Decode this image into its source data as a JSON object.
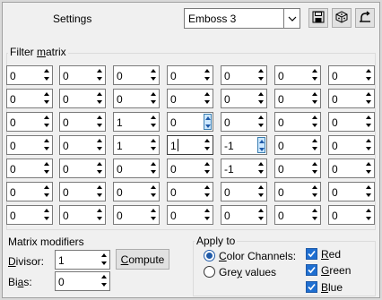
{
  "settings": {
    "label": "Settings",
    "preset_value": "Emboss 3"
  },
  "icons": {
    "save": "save-icon",
    "load": "dice-icon",
    "reset": "reset-icon",
    "dropdown": "chevron-down-icon"
  },
  "matrix": {
    "title_pre": "Filter ",
    "title_u": "m",
    "title_post": "atrix",
    "rows": [
      [
        "0",
        "0",
        "0",
        "0",
        "0",
        "0",
        "0"
      ],
      [
        "0",
        "0",
        "0",
        "0",
        "0",
        "0",
        "0"
      ],
      [
        "0",
        "0",
        "1",
        "0",
        "0",
        "0",
        "0"
      ],
      [
        "0",
        "0",
        "1",
        "1",
        "-1",
        "0",
        "0"
      ],
      [
        "0",
        "0",
        "0",
        "0",
        "-1",
        "0",
        "0"
      ],
      [
        "0",
        "0",
        "0",
        "0",
        "0",
        "0",
        "0"
      ],
      [
        "0",
        "0",
        "0",
        "0",
        "0",
        "0",
        "0"
      ]
    ]
  },
  "modifiers": {
    "title": "Matrix modifiers",
    "divisor_label_u": "D",
    "divisor_label_rest": "ivisor:",
    "divisor_value": "1",
    "compute_u": "C",
    "compute_rest": "ompute",
    "bias_label_pre": "Bi",
    "bias_label_u": "a",
    "bias_label_post": "s:",
    "bias_value": "0"
  },
  "apply": {
    "title": "Apply to",
    "color_u": "C",
    "color_rest": "olor Channels:",
    "grey_pre": "Gre",
    "grey_u": "y",
    "grey_post": " values",
    "red_u": "R",
    "red_rest": "ed",
    "green_u": "G",
    "green_rest": "reen",
    "blue_u": "B",
    "blue_rest": "lue"
  }
}
